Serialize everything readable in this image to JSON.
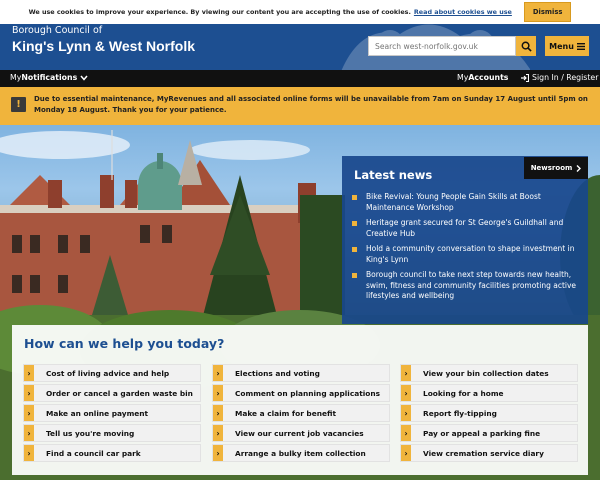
{
  "cookie_bar": {
    "message": "We use cookies to improve your experience. By viewing our content you are accepting the use of cookies.",
    "link_label": "Read about cookies we use",
    "dismiss_label": "Dismiss"
  },
  "header": {
    "logo_small": "Borough Council of",
    "logo_big": "King's Lynn & West Norfolk",
    "search_placeholder": "Search west-norfolk.gov.uk",
    "menu_label": "Menu",
    "brand_color": "#1d4f91",
    "accent_color": "#f0b43c"
  },
  "topnav": {
    "my_prefix": "My",
    "notifications_label": "Notifications",
    "accounts_prefix": "My",
    "accounts_label": "Accounts",
    "signin_label": "Sign In / Register"
  },
  "alert": {
    "icon": "exclamation-icon",
    "text": "Due to essential maintenance, MyRevenues and all associated online forms will be unavailable from 7am on Sunday 17 August until 5pm on Monday 18 August. Thank you for your patience."
  },
  "news": {
    "title": "Latest news",
    "newsroom_label": "Newsroom",
    "items": [
      "Bike Revival: Young People Gain Skills at Boost Maintenance Workshop",
      "Heritage grant secured for St George's Guildhall and Creative Hub",
      "Hold a community conversation to shape investment in King's Lynn",
      "Borough council to take next step towards new health, swim, fitness and community facilities promoting active lifestyles and wellbeing"
    ]
  },
  "help": {
    "title": "How can we help you today?",
    "columns": [
      [
        "Cost of living advice and help",
        "Order or cancel a garden waste bin",
        "Make an online payment",
        "Tell us you're moving",
        "Find a council car park"
      ],
      [
        "Elections and voting",
        "Comment on planning applications",
        "Make a claim for benefit",
        "View our current job vacancies",
        "Arrange a bulky item collection"
      ],
      [
        "View your bin collection dates",
        "Looking for a home",
        "Report fly-tipping",
        "Pay or appeal a parking fine",
        "View cremation service diary"
      ]
    ]
  }
}
